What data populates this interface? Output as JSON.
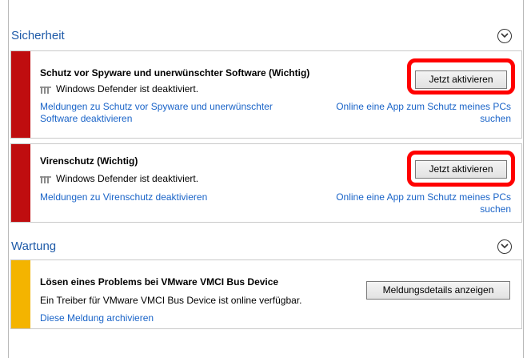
{
  "security": {
    "title": "Sicherheit",
    "items": [
      {
        "title": "Schutz vor Spyware und unerwünschter Software  (Wichtig)",
        "status": "Windows Defender ist deaktiviert.",
        "button": "Jetzt aktivieren",
        "left_link_line1": "Meldungen zu Schutz vor Spyware und unerwünschter",
        "left_link_line2": "Software deaktivieren",
        "right_link_line1": "Online eine App zum Schutz meines PCs",
        "right_link_line2": "suchen"
      },
      {
        "title": "Virenschutz  (Wichtig)",
        "status": "Windows Defender ist deaktiviert.",
        "button": "Jetzt aktivieren",
        "left_link_line1": "Meldungen zu Virenschutz deaktivieren",
        "right_link_line1": "Online eine App zum Schutz meines PCs",
        "right_link_line2": "suchen"
      }
    ]
  },
  "maintenance": {
    "title": "Wartung",
    "items": [
      {
        "title": "Lösen eines Problems bei VMware VMCI Bus Device",
        "status": "Ein Treiber für VMware VMCI Bus Device ist online verfügbar.",
        "button": "Meldungsdetails anzeigen",
        "link": "Diese Meldung archivieren"
      }
    ]
  },
  "colors": {
    "critical": "#bf0d0f",
    "warning": "#f4b400",
    "link": "#1a64c8",
    "highlight": "#ff0000"
  }
}
